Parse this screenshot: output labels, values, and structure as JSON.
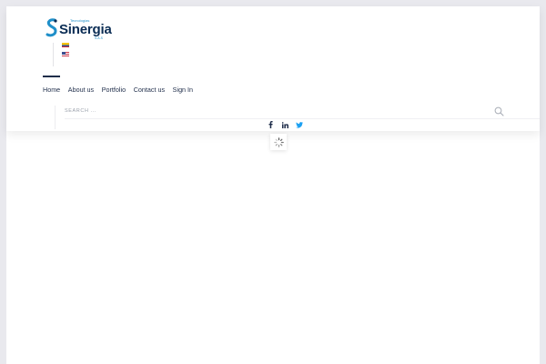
{
  "brand": {
    "tagline": "Tecnologías",
    "name": "Sinergia",
    "sub": "S.A.S"
  },
  "languages": [
    {
      "code": "es",
      "icon": "colombia-flag-icon"
    },
    {
      "code": "en",
      "icon": "usa-flag-icon"
    }
  ],
  "nav": {
    "items": [
      {
        "label": "Home",
        "active": true
      },
      {
        "label": "About us",
        "active": false
      },
      {
        "label": "Portfolio",
        "active": false
      },
      {
        "label": "Contact us",
        "active": false
      },
      {
        "label": "Sign In",
        "active": false
      }
    ]
  },
  "search": {
    "placeholder": "SEARCH ..."
  },
  "social": [
    {
      "icon": "facebook-icon"
    },
    {
      "icon": "linkedin-icon"
    },
    {
      "icon": "twitter-icon"
    }
  ],
  "colors": {
    "page_bg": "#e9e9ee",
    "nav_text": "#1f2d4a",
    "brand_dark": "#0a2c54",
    "brand_accent": "#1f8fc9",
    "twitter": "#1da1f2"
  }
}
